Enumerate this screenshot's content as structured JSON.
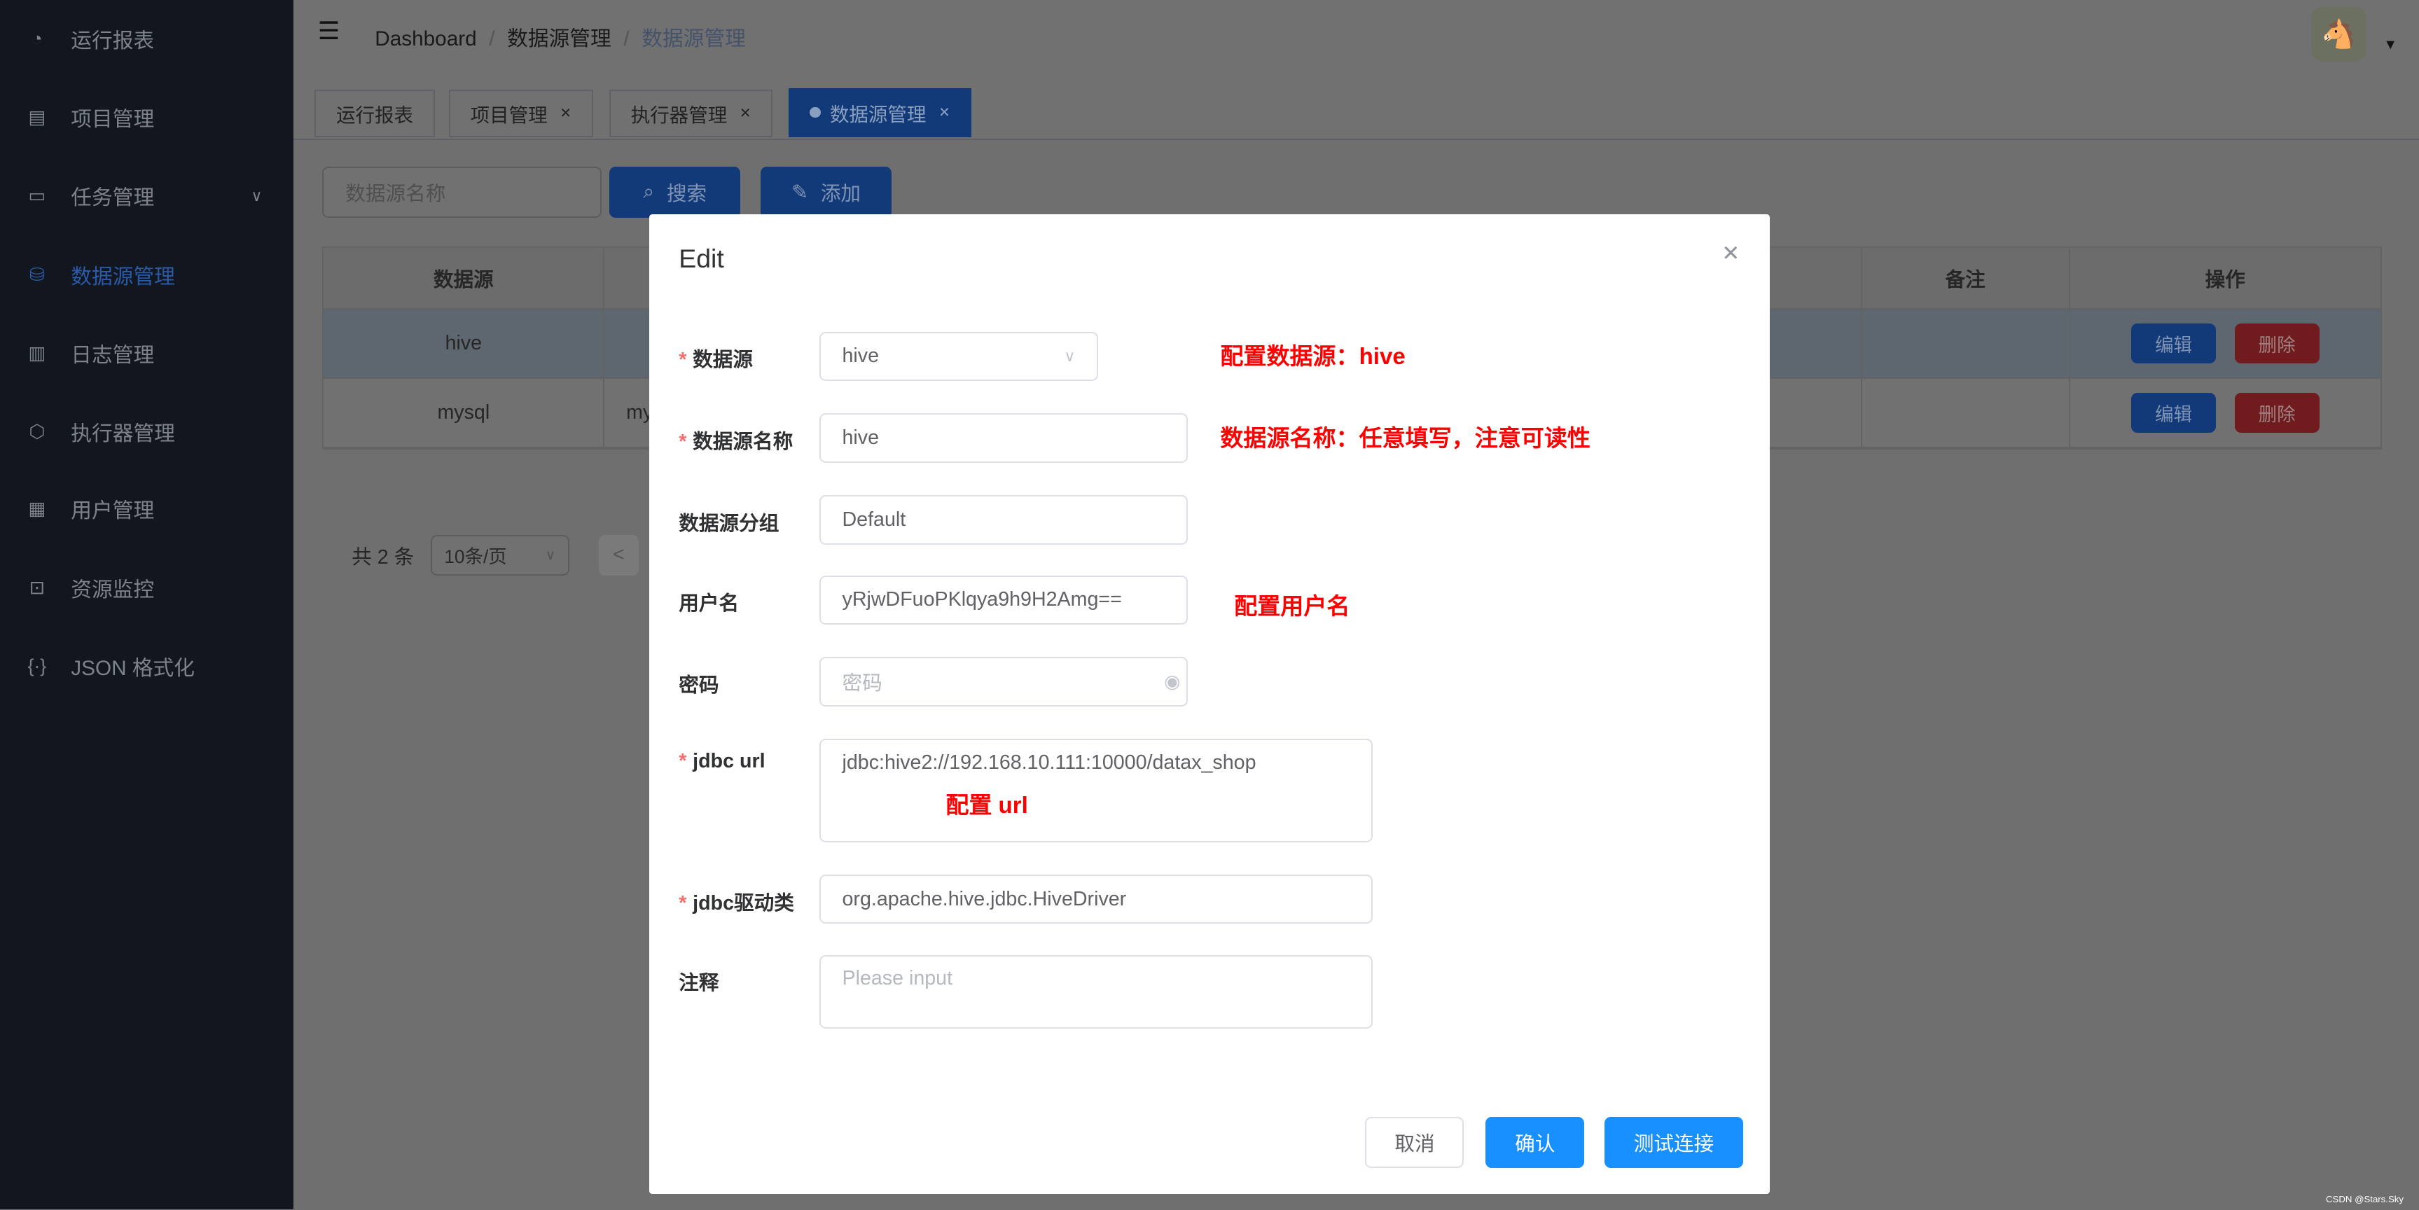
{
  "sidebar": {
    "items": [
      {
        "label": "运行报表",
        "icon": "dashboard-icon"
      },
      {
        "label": "项目管理",
        "icon": "project-icon"
      },
      {
        "label": "任务管理",
        "icon": "task-icon",
        "expandable": true
      },
      {
        "label": "数据源管理",
        "icon": "datasource-icon",
        "active": true
      },
      {
        "label": "日志管理",
        "icon": "log-icon"
      },
      {
        "label": "执行器管理",
        "icon": "executor-icon"
      },
      {
        "label": "用户管理",
        "icon": "user-grid-icon"
      },
      {
        "label": "资源监控",
        "icon": "monitor-icon"
      },
      {
        "label": "JSON 格式化",
        "icon": "json-icon"
      }
    ]
  },
  "header": {
    "breadcrumb": [
      "Dashboard",
      "数据源管理",
      "数据源管理"
    ]
  },
  "tags": [
    {
      "label": "运行报表"
    },
    {
      "label": "项目管理"
    },
    {
      "label": "执行器管理"
    },
    {
      "label": "数据源管理",
      "active": true
    }
  ],
  "toolbar": {
    "search_placeholder": "数据源名称",
    "search_label": "搜索",
    "add_label": "添加"
  },
  "table": {
    "columns": [
      "数据源",
      "备注",
      "操作"
    ],
    "rows": [
      {
        "datasource": "hive",
        "remark": "",
        "edit": "编辑",
        "delete": "删除"
      },
      {
        "datasource": "mysql",
        "second": "my",
        "remark": "",
        "edit": "编辑",
        "delete": "删除"
      }
    ]
  },
  "pagination": {
    "total": "共 2 条",
    "page_size": "10条/页",
    "prev": "<"
  },
  "modal": {
    "title": "Edit",
    "fields": {
      "datasource": {
        "label": "数据源",
        "value": "hive",
        "required": true
      },
      "name": {
        "label": "数据源名称",
        "value": "hive",
        "required": true
      },
      "group": {
        "label": "数据源分组",
        "value": "Default"
      },
      "username": {
        "label": "用户名",
        "value": "yRjwDFuoPKlqya9h9H2Amg=="
      },
      "password": {
        "label": "密码",
        "placeholder": "密码"
      },
      "jdbc_url": {
        "label": "jdbc url",
        "value": "jdbc:hive2://192.168.10.111:10000/datax_shop",
        "required": true
      },
      "driver": {
        "label": "jdbc驱动类",
        "value": "org.apache.hive.jdbc.HiveDriver",
        "required": true
      },
      "comment": {
        "label": "注释",
        "placeholder": "Please input"
      }
    },
    "buttons": {
      "cancel": "取消",
      "confirm": "确认",
      "test": "测试连接"
    }
  },
  "annotations": {
    "datasource": "配置数据源：hive",
    "name": "数据源名称：任意填写，注意可读性",
    "username": "配置用户名",
    "url": "配置 url"
  },
  "watermark": "CSDN @Stars.Sky",
  "colors": {
    "primary": "#1f6fe0",
    "danger": "#e0393e",
    "annotation": "#ff0000"
  }
}
